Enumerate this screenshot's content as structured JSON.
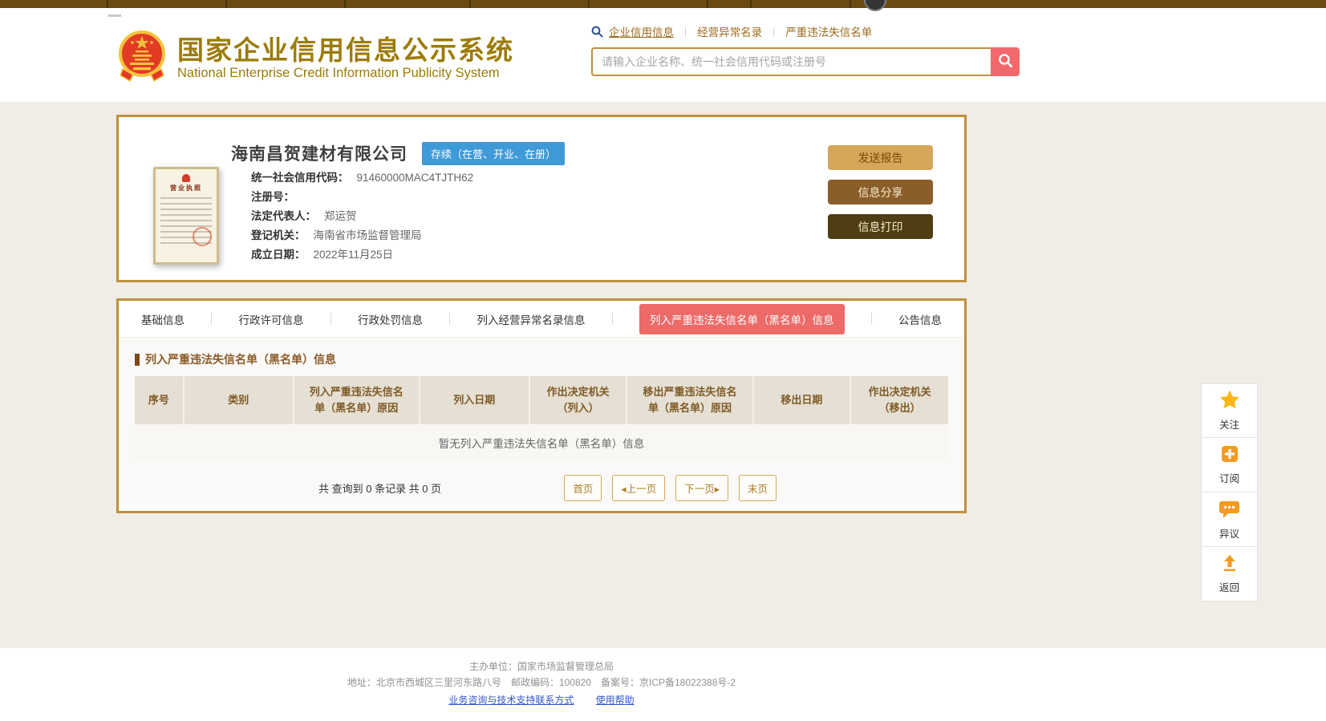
{
  "brand": {
    "title_cn": "国家企业信用信息公示系统",
    "title_en": "National Enterprise Credit Information Publicity System"
  },
  "search": {
    "tabs": [
      "企业信用信息",
      "经营异常名录",
      "严重违法失信名单"
    ],
    "placeholder": "请输入企业名称、统一社会信用代码或注册号"
  },
  "company": {
    "name": "海南昌贺建材有限公司",
    "status_badge": "存续（在营、开业、在册）",
    "license_title": "营业执照",
    "fields": [
      {
        "label": "统一社会信用代码：",
        "value": "91460000MAC4TJTH62"
      },
      {
        "label": "注册号：",
        "value": ""
      },
      {
        "label": "法定代表人：",
        "value": "郑运贺"
      },
      {
        "label": "登记机关：",
        "value": "海南省市场监督管理局"
      },
      {
        "label": "成立日期：",
        "value": "2022年11月25日"
      }
    ],
    "actions": [
      {
        "label": "发送报告"
      },
      {
        "label": "信息分享"
      },
      {
        "label": "信息打印"
      }
    ]
  },
  "tabs": [
    {
      "label": "基础信息"
    },
    {
      "label": "行政许可信息"
    },
    {
      "label": "行政处罚信息"
    },
    {
      "label": "列入经营异常名录信息"
    },
    {
      "label": "列入严重违法失信名单（黑名单）信息"
    },
    {
      "label": "公告信息"
    }
  ],
  "blacklist_section": {
    "title": "列入严重违法失信名单（黑名单）信息",
    "table_headers": [
      {
        "line1": "序号",
        "line2": ""
      },
      {
        "line1": "类别",
        "line2": ""
      },
      {
        "line1": "列入严重违法失信名",
        "line2": "单（黑名单）原因"
      },
      {
        "line1": "列入日期",
        "line2": ""
      },
      {
        "line1": "作出决定机关",
        "line2": "（列入）"
      },
      {
        "line1": "移出严重违法失信名",
        "line2": "单（黑名单）原因"
      },
      {
        "line1": "移出日期",
        "line2": ""
      },
      {
        "line1": "作出决定机关",
        "line2": "（移出）"
      }
    ],
    "empty_message": "暂无列入严重违法失信名单（黑名单）信息",
    "pagination": {
      "summary": "共 查询到 0 条记录 共 0 页",
      "first": "首页",
      "prev": "◂上一页",
      "next": "下一页▸",
      "last": "末页"
    }
  },
  "side_widgets": [
    {
      "label": "关注"
    },
    {
      "label": "订阅"
    },
    {
      "label": "异议"
    },
    {
      "label": "返回"
    }
  ],
  "footer": {
    "organizer": "主办单位：国家市场监督管理总局",
    "address_line": "地址：北京市西城区三里河东路八号　邮政编码：100820　备案号：京ICP备18022388号-2",
    "links": [
      "业务咨询与技术支持联系方式",
      "使用帮助"
    ]
  },
  "colors": {
    "brand_gold": "#9c7b08",
    "card_border": "#bf913d",
    "topbar_brown": "#6b4a10",
    "active_tab_red": "#ec6a68",
    "status_blue": "#3f9ad8",
    "search_button_pink": "#f2686b",
    "table_header_bg": "#e6dfd3",
    "table_header_text": "#7d5b26",
    "sidebar_orange": "#f59a23",
    "sidebar_star_gold": "#fcb714"
  }
}
